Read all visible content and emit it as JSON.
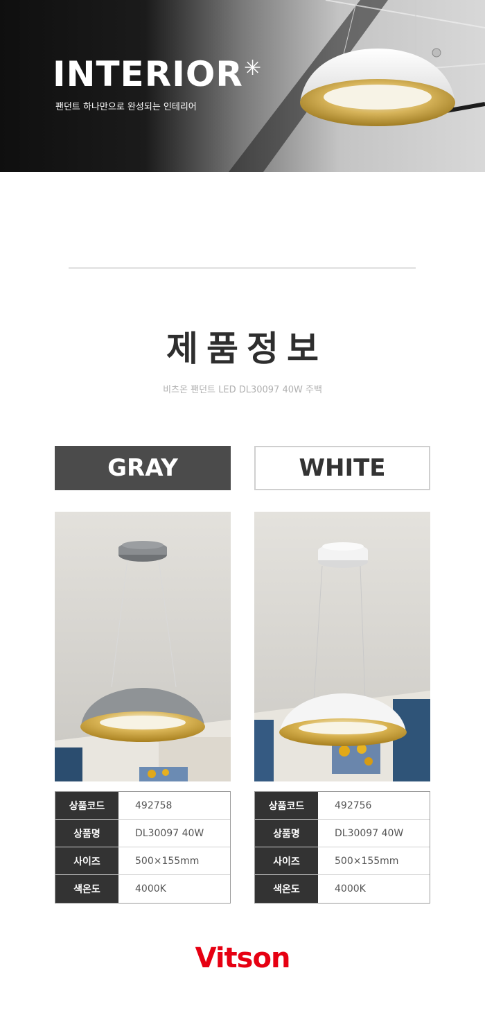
{
  "hero": {
    "title": "INTERIOR",
    "star": "✳",
    "subtitle": "팬던트 하나만으로 완성되는 인테리어"
  },
  "section": {
    "title": "제품정보",
    "subtitle": "비츠온 팬던트 LED DL30097 40W 주백"
  },
  "products": [
    {
      "color_label": "GRAY",
      "shade_color": "#8f9396",
      "canopy_color": "#8a8d90",
      "specs": [
        {
          "key": "상품코드",
          "value": "492758"
        },
        {
          "key": "상품명",
          "value": "DL30097 40W"
        },
        {
          "key": "사이즈",
          "value": "500×155mm"
        },
        {
          "key": "색온도",
          "value": "4000K"
        }
      ]
    },
    {
      "color_label": "WHITE",
      "shade_color": "#f4f4f4",
      "canopy_color": "#f0f0f0",
      "specs": [
        {
          "key": "상품코드",
          "value": "492756"
        },
        {
          "key": "상품명",
          "value": "DL30097 40W"
        },
        {
          "key": "사이즈",
          "value": "500×155mm"
        },
        {
          "key": "색온도",
          "value": "4000K"
        }
      ]
    }
  ],
  "brand": {
    "logo_text": "Vitson",
    "logo_color": "#e60012"
  },
  "colors": {
    "gold_inner": "#c9a23a",
    "dark_button": "#4b4b4b"
  }
}
